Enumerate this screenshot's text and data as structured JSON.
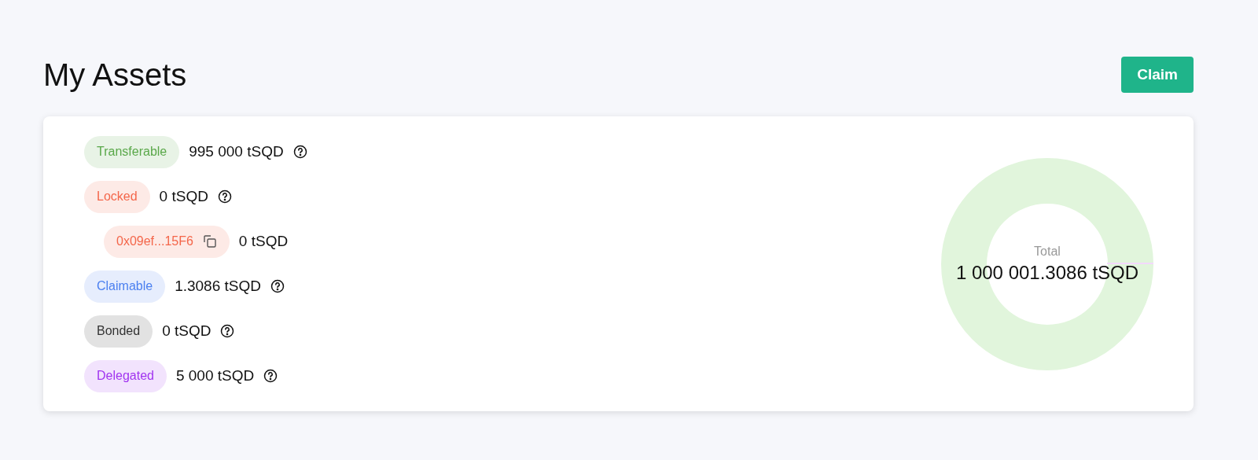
{
  "page": {
    "title": "My Assets",
    "action": "Claim"
  },
  "assets": [
    {
      "label": "Transferable",
      "amount": "995 000 tSQD",
      "color": "#5aa84a",
      "info": true
    },
    {
      "label": "Locked",
      "amount": "0 tSQD",
      "color": "#f4664a",
      "info": true,
      "children": [
        {
          "label": "0x09ef...15F6",
          "amount": "0 tSQD",
          "color": "#f4664a",
          "info": false,
          "copyable": true
        }
      ]
    },
    {
      "label": "Claimable",
      "amount": "1.3086 tSQD",
      "color": "#4a7ff0",
      "info": true
    },
    {
      "label": "Bonded",
      "amount": "0 tSQD",
      "color": "#333333",
      "info": true
    },
    {
      "label": "Delegated",
      "amount": "5 000 tSQD",
      "color": "#a134f0",
      "info": true
    }
  ],
  "total": {
    "label": "Total",
    "value": "1 000 001.3086 tSQD"
  }
}
